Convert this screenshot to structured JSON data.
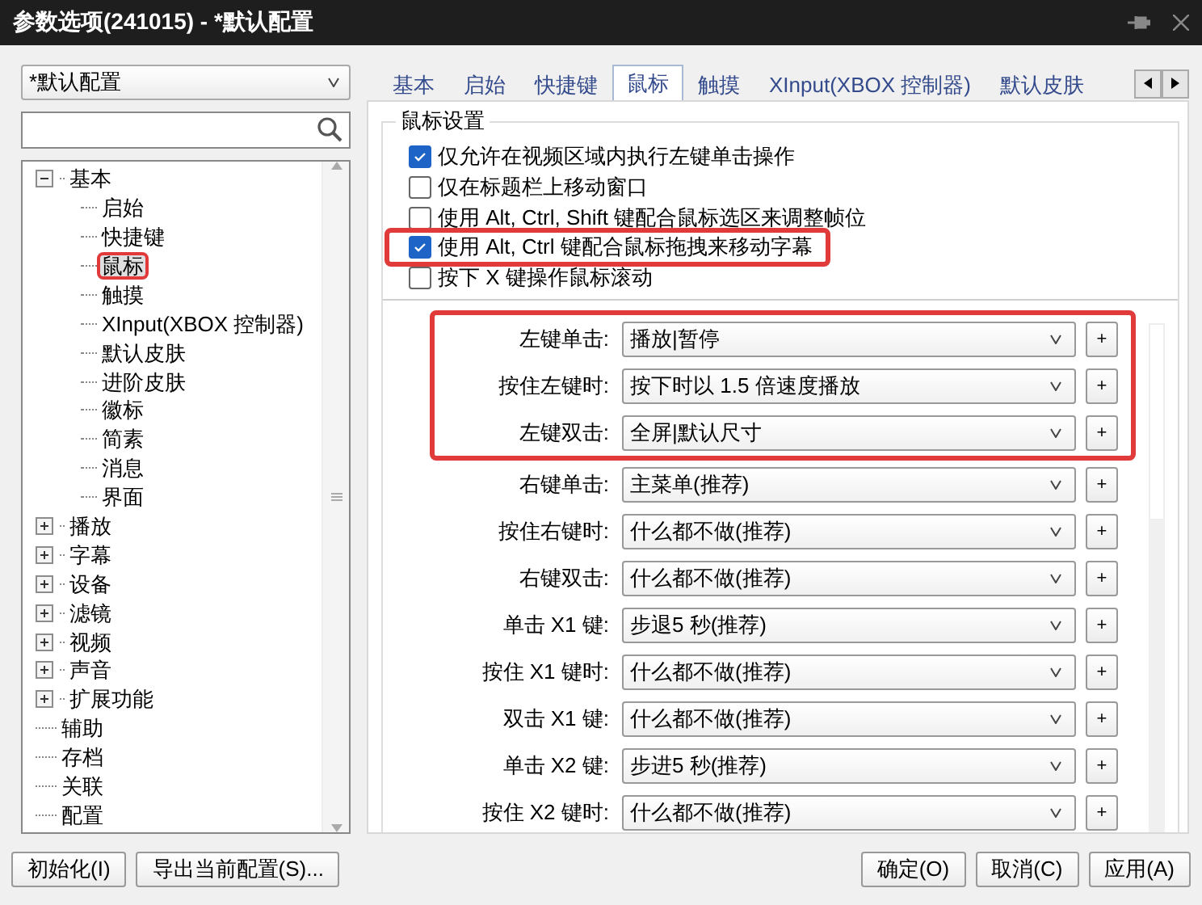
{
  "window": {
    "title": "参数选项(241015) - *默认配置"
  },
  "profile": {
    "value": "*默认配置"
  },
  "tree": [
    {
      "label": "基本",
      "expanded": true,
      "selected": false,
      "children": [
        {
          "label": "启始",
          "selected": false
        },
        {
          "label": "快捷键",
          "selected": false
        },
        {
          "label": "鼠标",
          "selected": true,
          "highlighted": true
        },
        {
          "label": "触摸",
          "selected": false
        },
        {
          "label": "XInput(XBOX 控制器)",
          "selected": false
        },
        {
          "label": "默认皮肤",
          "selected": false
        },
        {
          "label": "进阶皮肤",
          "selected": false
        },
        {
          "label": "徽标",
          "selected": false
        },
        {
          "label": "简素",
          "selected": false
        },
        {
          "label": "消息",
          "selected": false
        },
        {
          "label": "界面",
          "selected": false
        }
      ]
    },
    {
      "label": "播放",
      "expanded": false,
      "selected": false
    },
    {
      "label": "字幕",
      "expanded": false,
      "selected": false
    },
    {
      "label": "设备",
      "expanded": false,
      "selected": false
    },
    {
      "label": "滤镜",
      "expanded": false,
      "selected": false
    },
    {
      "label": "视频",
      "expanded": false,
      "selected": false
    },
    {
      "label": "声音",
      "expanded": false,
      "selected": false
    },
    {
      "label": "扩展功能",
      "expanded": false,
      "selected": false
    },
    {
      "label": "辅助",
      "selected": false
    },
    {
      "label": "存档",
      "selected": false
    },
    {
      "label": "关联",
      "selected": false
    },
    {
      "label": "配置",
      "selected": false
    }
  ],
  "tabs": [
    {
      "label": "基本",
      "selected": false
    },
    {
      "label": "启始",
      "selected": false
    },
    {
      "label": "快捷键",
      "selected": false
    },
    {
      "label": "鼠标",
      "selected": true
    },
    {
      "label": "触摸",
      "selected": false
    },
    {
      "label": "XInput(XBOX 控制器)",
      "selected": false
    },
    {
      "label": "默认皮肤",
      "selected": false
    }
  ],
  "group": {
    "title": "鼠标设置",
    "options": [
      {
        "label": "仅允许在视频区域内执行左键单击操作",
        "checked": true,
        "highlighted": false
      },
      {
        "label": "仅在标题栏上移动窗口",
        "checked": false,
        "highlighted": false
      },
      {
        "label": "使用 Alt, Ctrl, Shift 键配合鼠标选区来调整帧位",
        "checked": false,
        "highlighted": false
      },
      {
        "label": "使用 Alt, Ctrl 键配合鼠标拖拽来移动字幕",
        "checked": true,
        "highlighted": true
      },
      {
        "label": "按下 X 键操作鼠标滚动",
        "checked": false,
        "highlighted": false
      }
    ]
  },
  "actions": [
    {
      "label": "左键单击:",
      "value": "播放|暂停",
      "highlighted": true
    },
    {
      "label": "按住左键时:",
      "value": "按下时以 1.5 倍速度播放",
      "highlighted": true
    },
    {
      "label": "左键双击:",
      "value": "全屏|默认尺寸",
      "highlighted": true
    },
    {
      "label": "右键单击:",
      "value": "主菜单(推荐)",
      "highlighted": false
    },
    {
      "label": "按住右键时:",
      "value": "什么都不做(推荐)",
      "highlighted": false
    },
    {
      "label": "右键双击:",
      "value": "什么都不做(推荐)",
      "highlighted": false
    },
    {
      "label": "单击 X1 键:",
      "value": "步退5 秒(推荐)",
      "highlighted": false
    },
    {
      "label": "按住 X1 键时:",
      "value": "什么都不做(推荐)",
      "highlighted": false
    },
    {
      "label": "双击 X1 键:",
      "value": "什么都不做(推荐)",
      "highlighted": false
    },
    {
      "label": "单击 X2 键:",
      "value": "步进5 秒(推荐)",
      "highlighted": false
    },
    {
      "label": "按住 X2 键时:",
      "value": "什么都不做(推荐)",
      "highlighted": false
    }
  ],
  "add_button": "+",
  "footer": {
    "left": [
      "初始化(I)",
      "导出当前配置(S)..."
    ],
    "right": [
      "确定(O)",
      "取消(C)",
      "应用(A)"
    ]
  }
}
